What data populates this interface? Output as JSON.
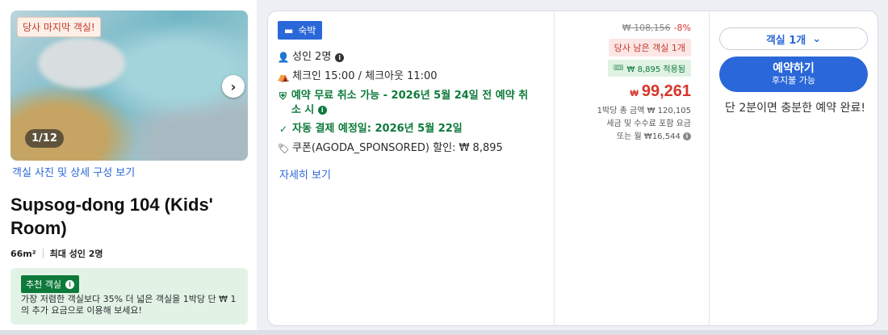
{
  "room": {
    "last_room_badge": "당사 마지막 객실!",
    "photo_counter": "1/12",
    "photos_link": "객실 사진 및 상세 구성 보기",
    "title": "Supsog-dong 104 (Kids' Room)",
    "size": "66m²",
    "max_guests": "최대 성인 2명",
    "recommended_badge": "추천 객실",
    "recommended_text": "가장 저렴한 객실보다 35% 더 넓은 객실을 1박당 단 ₩ 1의 추가 요금으로 이용해 보세요!"
  },
  "offer": {
    "stay_type": "숙박",
    "guests": "성인 2명",
    "checkin_checkout": "체크인 15:00 / 체크아웃 11:00",
    "free_cancel": "예약 무료 취소 가능 - 2026년 5월 24일 전 예약 취소 시",
    "auto_pay": "자동 결제 예정일: 2026년 5월 22일",
    "coupon": "쿠폰(AGODA_SPONSORED) 할인: ₩ 8,895",
    "details_link": "자세히 보기"
  },
  "price": {
    "original": "₩ 108,156",
    "discount_pct": "-8%",
    "rooms_left": "당사 남은 객실 1개",
    "coupon_applied": "₩ 8,895 적용됨",
    "currency": "₩",
    "amount": "99,261",
    "total_note": "1박당 총 금액 ₩ 120,105",
    "tax_note": "세금 및 수수료 포함 요금",
    "monthly_note": "또는 월 ₩16,544"
  },
  "booking": {
    "rooms_select": "객실 1개",
    "book_label": "예약하기",
    "pay_later": "후지불 가능",
    "urgency": "단 2분이면 충분한 예약 완료!"
  },
  "colors": {
    "accent": "#2a67d9",
    "price_red": "#d6352c",
    "green": "#0d7a3a"
  }
}
